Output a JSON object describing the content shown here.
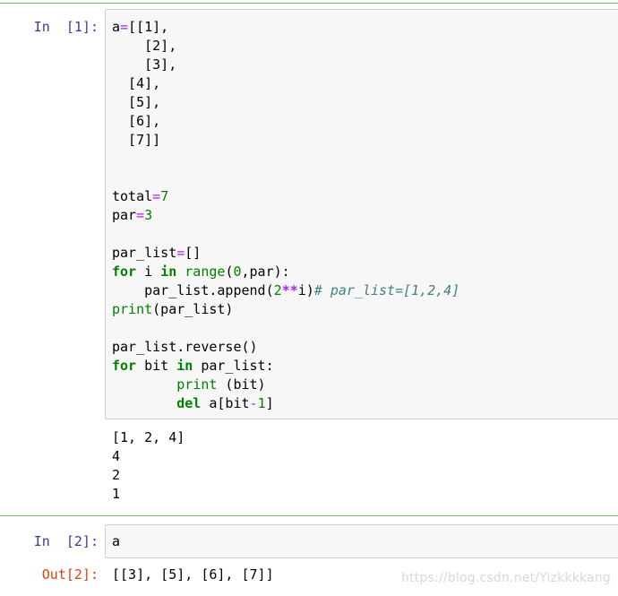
{
  "cells": [
    {
      "prompt": "In  [1]:",
      "code_lines": [
        [
          {
            "t": "a"
          },
          {
            "t": "=",
            "c": "op"
          },
          {
            "t": "[[1],"
          }
        ],
        [
          {
            "t": "    [2],"
          }
        ],
        [
          {
            "t": "    [3],"
          }
        ],
        [
          {
            "t": "  [4],"
          }
        ],
        [
          {
            "t": "  [5],"
          }
        ],
        [
          {
            "t": "  [6],"
          }
        ],
        [
          {
            "t": "  [7]]"
          }
        ],
        [],
        [],
        [
          {
            "t": "total"
          },
          {
            "t": "=",
            "c": "op"
          },
          {
            "t": "7",
            "c": "num"
          }
        ],
        [
          {
            "t": "par"
          },
          {
            "t": "=",
            "c": "op"
          },
          {
            "t": "3",
            "c": "num"
          }
        ],
        [],
        [
          {
            "t": "par_list"
          },
          {
            "t": "=",
            "c": "op"
          },
          {
            "t": "[]"
          }
        ],
        [
          {
            "t": "for",
            "c": "kw"
          },
          {
            "t": " i "
          },
          {
            "t": "in",
            "c": "kw"
          },
          {
            "t": " "
          },
          {
            "t": "range",
            "c": "bi"
          },
          {
            "t": "("
          },
          {
            "t": "0",
            "c": "num"
          },
          {
            "t": ",par):"
          }
        ],
        [
          {
            "t": "    par_list.append("
          },
          {
            "t": "2",
            "c": "num"
          },
          {
            "t": "**",
            "c": "opb"
          },
          {
            "t": "i)"
          },
          {
            "t": "# par_list=[1,2,4]",
            "c": "cm"
          }
        ],
        [
          {
            "t": "print",
            "c": "bi"
          },
          {
            "t": "(par_list)"
          }
        ],
        [],
        [
          {
            "t": "par_list.reverse()"
          }
        ],
        [
          {
            "t": "for",
            "c": "kw"
          },
          {
            "t": " bit "
          },
          {
            "t": "in",
            "c": "kw"
          },
          {
            "t": " par_list:"
          }
        ],
        [
          {
            "t": "        "
          },
          {
            "t": "print",
            "c": "bi"
          },
          {
            "t": " (bit)"
          }
        ],
        [
          {
            "t": "        "
          },
          {
            "t": "del",
            "c": "kw"
          },
          {
            "t": " a[bit"
          },
          {
            "t": "-",
            "c": "op"
          },
          {
            "t": "1",
            "c": "num"
          },
          {
            "t": "]"
          }
        ]
      ],
      "output_lines": [
        "[1, 2, 4]",
        "4",
        "2",
        "1"
      ]
    },
    {
      "prompt": "In  [2]:",
      "code_lines": [
        [
          {
            "t": "a"
          }
        ]
      ],
      "out_prompt": "Out[2]:",
      "output_lines": [
        "[[3], [5], [6], [7]]"
      ]
    }
  ],
  "watermark": "https://blog.csdn.net/Yizkkkkang",
  "colors": {
    "in_prompt": "#303f9f",
    "out_prompt": "#d84315",
    "keyword": "#008000",
    "operator": "#aa22ff",
    "comment": "#408080",
    "cell_border": "#66bb6a",
    "input_bg": "#f7f7f7"
  }
}
